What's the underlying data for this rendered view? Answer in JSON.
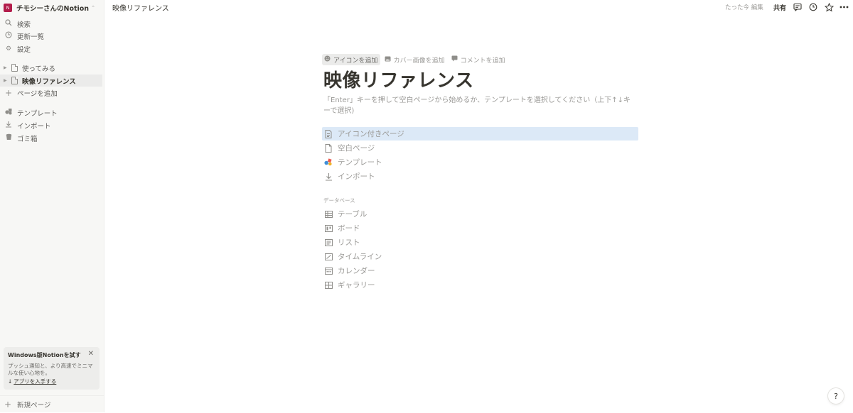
{
  "sidebar": {
    "workspace": {
      "badge": "N",
      "name": "チモシーさんのNotion"
    },
    "nav": [
      {
        "label": "検索",
        "icon": "search-icon"
      },
      {
        "label": "更新一覧",
        "icon": "clock-icon"
      },
      {
        "label": "設定",
        "icon": "gear-icon"
      }
    ],
    "pages": [
      {
        "label": "使ってみる",
        "active": false
      },
      {
        "label": "映像リファレンス",
        "active": true
      }
    ],
    "add_page": "ページを追加",
    "tools": [
      {
        "label": "テンプレート",
        "icon": "shapes-icon"
      },
      {
        "label": "インポート",
        "icon": "download-icon"
      },
      {
        "label": "ゴミ箱",
        "icon": "trash-icon"
      }
    ],
    "promo": {
      "title": "Windows版Notionを試す",
      "body": "プッシュ通知と、より高速でミニマルな使い心地を。",
      "link": "アプリを入手する"
    },
    "new_page": "新規ページ"
  },
  "topbar": {
    "breadcrumb": "映像リファレンス",
    "edited": "たった今 編集",
    "share": "共有"
  },
  "page": {
    "actions": [
      {
        "label": "アイコンを追加",
        "icon": "smile-icon"
      },
      {
        "label": "カバー画像を追加",
        "icon": "image-icon"
      },
      {
        "label": "コメントを追加",
        "icon": "comment-icon"
      }
    ],
    "title": "映像リファレンス",
    "hint": "「Enter」キーを押して空白ページから始めるか、テンプレートを選択してください（上下↑↓キーで選択)",
    "options": [
      {
        "label": "アイコン付きページ",
        "icon": "page-icon"
      },
      {
        "label": "空白ページ",
        "icon": "blank-page-icon"
      },
      {
        "label": "テンプレート",
        "icon": "shapes-icon"
      },
      {
        "label": "インポート",
        "icon": "download-icon"
      }
    ],
    "database_label": "データベース",
    "databases": [
      {
        "label": "テーブル",
        "icon": "table-icon"
      },
      {
        "label": "ボード",
        "icon": "board-icon"
      },
      {
        "label": "リスト",
        "icon": "list-icon"
      },
      {
        "label": "タイムライン",
        "icon": "timeline-icon"
      },
      {
        "label": "カレンダー",
        "icon": "calendar-icon"
      },
      {
        "label": "ギャラリー",
        "icon": "gallery-icon"
      }
    ]
  },
  "colors": {
    "accent": "#b31d4b",
    "selection": "#dce9f7",
    "sidebar_bg": "#f7f7f5"
  },
  "help": "?"
}
